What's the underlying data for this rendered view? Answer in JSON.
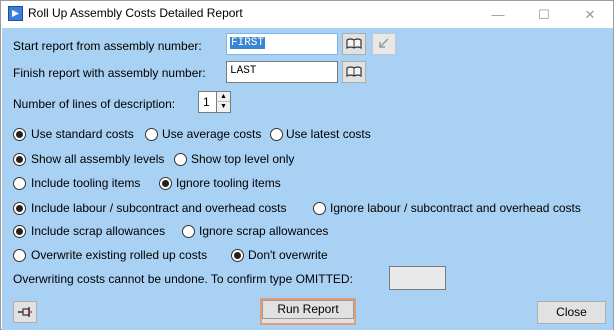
{
  "window": {
    "title": "Roll Up Assembly Costs Detailed Report",
    "minimize_glyph": "—",
    "maximize_glyph": "☐",
    "close_glyph": "✕"
  },
  "start": {
    "label": "Start report from assembly number:",
    "value": "FIRST"
  },
  "finish": {
    "label": "Finish report with assembly number:",
    "value": "LAST"
  },
  "description_lines": {
    "label": "Number of lines of description:",
    "value": "1"
  },
  "cost_method": {
    "options": [
      "Use standard costs",
      "Use average costs",
      "Use latest costs"
    ],
    "selected": "Use standard costs"
  },
  "levels": {
    "options": [
      "Show all assembly levels",
      "Show top level only"
    ],
    "selected": "Show all assembly levels"
  },
  "tooling": {
    "options": [
      "Include tooling items",
      "Ignore tooling items"
    ],
    "selected": "Ignore tooling items"
  },
  "labour": {
    "options": [
      "Include labour / subcontract and overhead costs",
      "Ignore labour / subcontract and overhead costs"
    ],
    "selected": "Include labour / subcontract and overhead costs"
  },
  "scrap": {
    "options": [
      "Include scrap allowances",
      "Ignore scrap allowances"
    ],
    "selected": "Include scrap allowances"
  },
  "overwrite": {
    "options": [
      "Overwrite existing rolled up costs",
      "Don't overwrite"
    ],
    "selected": "Don't overwrite"
  },
  "confirm": {
    "label": "Overwriting costs cannot be undone.  To confirm type OMITTED:",
    "value": ""
  },
  "buttons": {
    "run_report": "Run Report",
    "close": "Close"
  },
  "colors": {
    "client_background": "#a9d1f3",
    "selection": "#3a86d4",
    "default_button_border": "#e09d7a"
  }
}
